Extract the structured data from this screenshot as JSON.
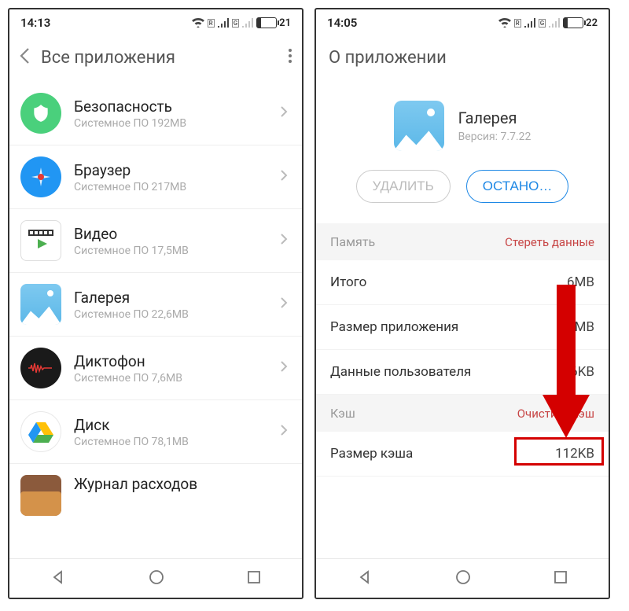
{
  "left": {
    "status": {
      "time": "14:13",
      "battery_pct": "21",
      "sig_r": "R",
      "sig_g": "G"
    },
    "header": {
      "title": "Все приложения"
    },
    "apps": [
      {
        "name": "Безопасность",
        "sub": "Системное ПО   192MB",
        "icon": "security"
      },
      {
        "name": "Браузер",
        "sub": "Системное ПО   217MB",
        "icon": "browser"
      },
      {
        "name": "Видео",
        "sub": "Системное ПО   17,5MB",
        "icon": "video"
      },
      {
        "name": "Галерея",
        "sub": "Системное ПО   22,6MB",
        "icon": "gallery"
      },
      {
        "name": "Диктофон",
        "sub": "Системное ПО   7,6MB",
        "icon": "recorder"
      },
      {
        "name": "Диск",
        "sub": "Системное ПО   78,1MB",
        "icon": "drive"
      },
      {
        "name": "Журнал расходов",
        "sub": "",
        "icon": "wallet"
      }
    ]
  },
  "right": {
    "status": {
      "time": "14:05",
      "battery_pct": "22",
      "sig_r": "R",
      "sig_g": "G"
    },
    "header": {
      "title": "О приложении"
    },
    "detail": {
      "name": "Галерея",
      "version": "Версия: 7.7.22"
    },
    "actions": {
      "uninstall": "УДАЛИТЬ",
      "stop": "ОСТАНО…"
    },
    "memory_section": {
      "label": "Память",
      "action": "Стереть данные"
    },
    "memory": [
      {
        "k": "Итого",
        "v": "6MB"
      },
      {
        "k": "Размер приложения",
        "v": "MB"
      },
      {
        "k": "Данные пользователя",
        "v": "96KB"
      }
    ],
    "cache_section": {
      "label": "Кэш",
      "action": "Очистить кэш"
    },
    "cache": [
      {
        "k": "Размер кэша",
        "v": "112KB"
      }
    ]
  }
}
